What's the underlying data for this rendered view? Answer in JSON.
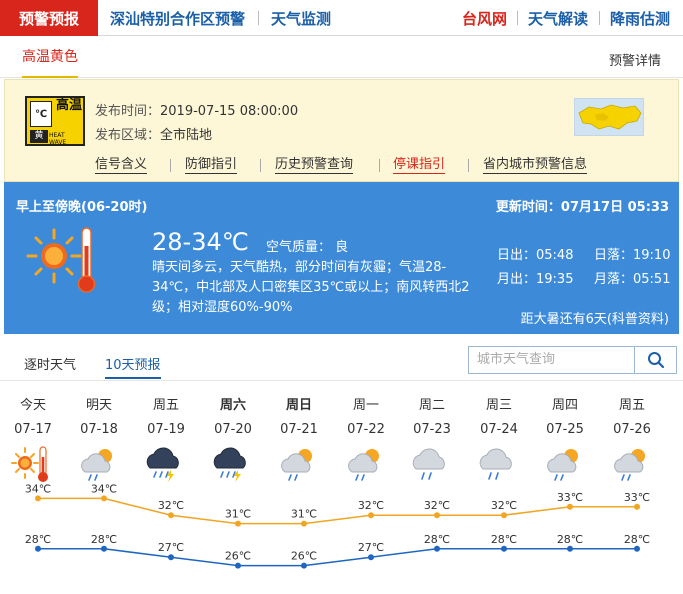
{
  "nav": {
    "active": "预警预报",
    "left_items": [
      "深汕特别合作区预警",
      "天气监测"
    ],
    "right_items": [
      {
        "label": "台风网",
        "color": "#d9261c"
      },
      {
        "label": "天气解读",
        "color": "#1b5fa8"
      },
      {
        "label": "降雨估测",
        "color": "#1b5fa8"
      }
    ]
  },
  "warning": {
    "tab": "高温黄色",
    "detail_link": "预警详情",
    "badge": {
      "symbol": "℃",
      "name": "高温",
      "level": "黄",
      "en": "HEAT WAVE"
    },
    "issue_label": "发布时间：",
    "issue_time": "2019-07-15 08:00:00",
    "area_label": "发布区域：",
    "area": "全市陆地",
    "links": [
      "信号含义",
      "防御指引",
      "历史预警查询",
      "停课指引",
      "省内城市预警信息"
    ]
  },
  "forecast": {
    "period": "早上至傍晚(06-20时)",
    "update": "更新时间：07月17日 05:33",
    "temp": "28-34℃",
    "air_quality": "空气质量： 良",
    "description": "晴天间多云，天气酷热，部分时间有灰霾；气温28-34℃，中北部及人口密集区35℃或以上；南风转西北2级；相对湿度60%-90%",
    "sunrise": "日出：05:48",
    "sunset": "日落：19:10",
    "moonrise": "月出：19:35",
    "moonset": "月落：05:51",
    "solar_term": "距大暑还有6天(科普资料)"
  },
  "tabs": [
    "逐时天气",
    "10天预报"
  ],
  "search": {
    "placeholder": "城市天气查询"
  },
  "days": [
    {
      "week": "今天",
      "date": "07-17",
      "icon": "sunny-hot-icon",
      "bold": false
    },
    {
      "week": "明天",
      "date": "07-18",
      "icon": "cloudy-rain-sun-icon",
      "bold": false
    },
    {
      "week": "周五",
      "date": "07-19",
      "icon": "thunder-rain-icon",
      "bold": false
    },
    {
      "week": "周六",
      "date": "07-20",
      "icon": "thunder-rain-icon",
      "bold": true
    },
    {
      "week": "周日",
      "date": "07-21",
      "icon": "cloudy-rain-sun-icon",
      "bold": true
    },
    {
      "week": "周一",
      "date": "07-22",
      "icon": "cloudy-rain-sun-icon",
      "bold": false
    },
    {
      "week": "周二",
      "date": "07-23",
      "icon": "cloud-rain-icon",
      "bold": false
    },
    {
      "week": "周三",
      "date": "07-24",
      "icon": "cloud-rain-icon",
      "bold": false
    },
    {
      "week": "周四",
      "date": "07-25",
      "icon": "cloudy-rain-sun-icon",
      "bold": false
    },
    {
      "week": "周五",
      "date": "07-26",
      "icon": "cloudy-rain-sun-icon",
      "bold": false
    }
  ],
  "chart_data": {
    "type": "line",
    "x": [
      "07-17",
      "07-18",
      "07-19",
      "07-20",
      "07-21",
      "07-22",
      "07-23",
      "07-24",
      "07-25",
      "07-26"
    ],
    "series": [
      {
        "values": [
          34,
          34,
          32,
          31,
          31,
          32,
          32,
          32,
          33,
          33
        ],
        "color": "#f0a623"
      },
      {
        "values": [
          28,
          28,
          27,
          26,
          26,
          27,
          28,
          28,
          28,
          28
        ],
        "color": "#1f66c2"
      }
    ],
    "unit": "℃",
    "ylim": [
      25,
      35
    ]
  }
}
